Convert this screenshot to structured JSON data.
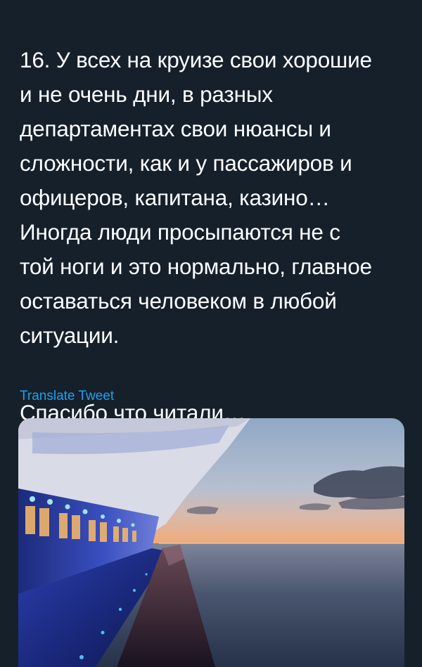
{
  "tweet": {
    "paragraphs": [
      "16. У всех на круизе свои хорошие\nи не очень дни, в разных\nдепартаментах свои нюансы и\nсложности, как и у пассажиров и\nофицеров, капитана, казино…\nИногда люди просыпаются не с\nтой ноги и это нормально, главное\nоставаться человеком в любой\nситуации.",
      "Спасибо что читали…"
    ],
    "translate_label": "Translate Tweet"
  },
  "colors": {
    "background": "#15202b",
    "text": "#ffffff",
    "link": "#1da1f2"
  }
}
